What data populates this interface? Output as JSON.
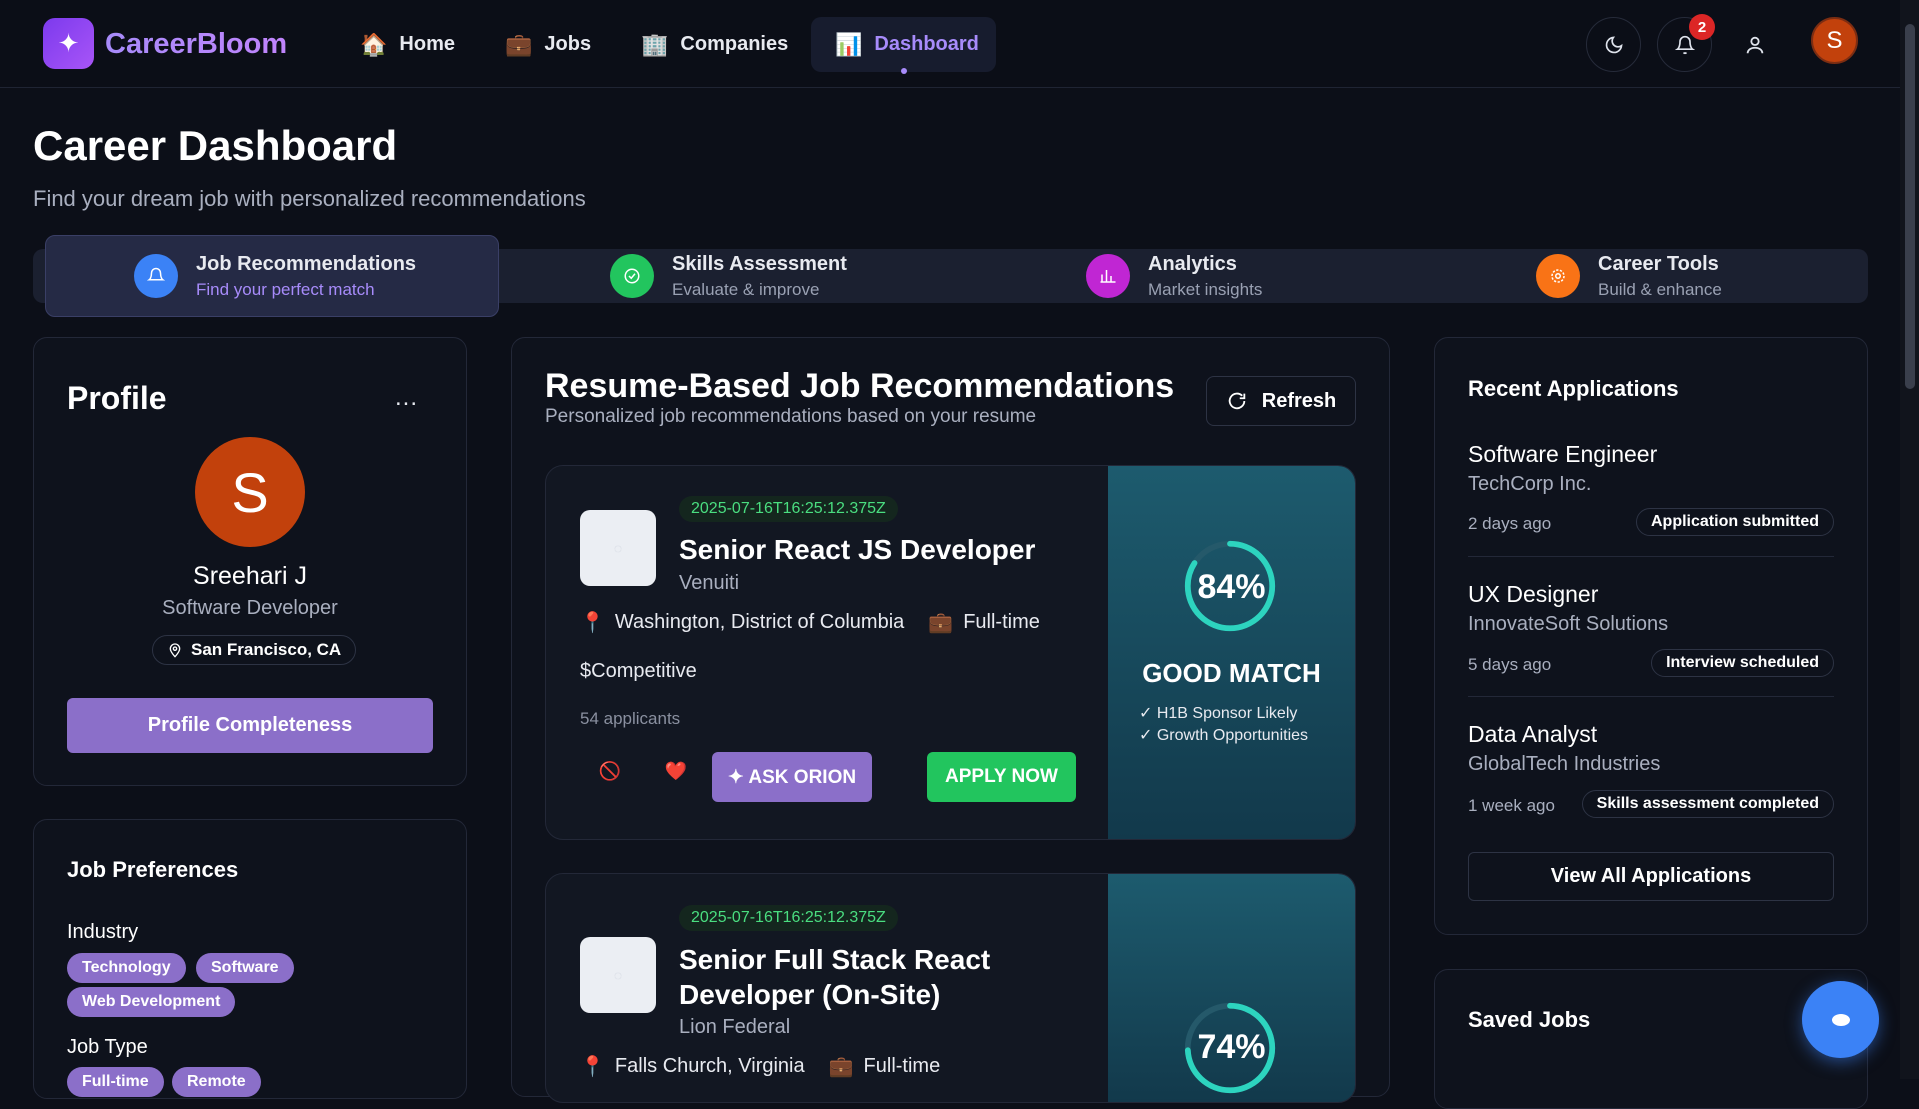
{
  "brand": {
    "name": "CareerBloom"
  },
  "nav": {
    "home": "Home",
    "jobs": "Jobs",
    "companies": "Companies",
    "dashboard": "Dashboard"
  },
  "notifications": {
    "count": "2"
  },
  "user": {
    "initial": "S"
  },
  "page": {
    "title": "Career Dashboard",
    "subtitle": "Find your dream job with personalized recommendations"
  },
  "tabs": [
    {
      "name": "Job Recommendations",
      "sub": "Find your perfect match",
      "color": "#3b82f6"
    },
    {
      "name": "Skills Assessment",
      "sub": "Evaluate & improve",
      "color": "#22c55e"
    },
    {
      "name": "Analytics",
      "sub": "Market insights",
      "color": "#c026d3"
    },
    {
      "name": "Career Tools",
      "sub": "Build & enhance",
      "color": "#f97316"
    }
  ],
  "profile": {
    "title": "Profile",
    "more": "...",
    "initial": "S",
    "name": "Sreehari J",
    "role": "Software Developer",
    "location": "San Francisco, CA",
    "completeness_label": "Profile Completeness"
  },
  "preferences": {
    "title": "Job Preferences",
    "industry_label": "Industry",
    "industries": [
      "Technology",
      "Software",
      "Web Development"
    ],
    "job_type_label": "Job Type",
    "job_types": [
      "Full-time",
      "Remote"
    ]
  },
  "recommendations": {
    "title": "Resume-Based Job Recommendations",
    "subtitle": "Personalized job recommendations based on your resume",
    "refresh_label": "Refresh",
    "jobs": [
      {
        "date": "2025-07-16T16:25:12.375Z",
        "title": "Senior React JS Developer",
        "company": "Venuiti",
        "location": "Washington, District of Columbia",
        "type": "Full-time",
        "salary": "$Competitive",
        "applicants": "54 applicants",
        "ask_label": "✦ ASK ORION",
        "apply_label": "APPLY NOW",
        "match_percent": "84%",
        "match_value": 84,
        "match_label": "GOOD MATCH",
        "points": [
          "✓ H1B Sponsor Likely",
          "✓ Growth Opportunities"
        ]
      },
      {
        "date": "2025-07-16T16:25:12.375Z",
        "title": "Senior Full Stack React Developer (On-Site)",
        "company": "Lion Federal",
        "location": "Falls Church, Virginia",
        "type": "Full-time",
        "match_percent": "74%",
        "match_value": 74
      }
    ]
  },
  "recent_applications": {
    "title": "Recent Applications",
    "items": [
      {
        "job": "Software Engineer",
        "company": "TechCorp Inc.",
        "when": "2 days ago",
        "status": "Application submitted"
      },
      {
        "job": "UX Designer",
        "company": "InnovateSoft Solutions",
        "when": "5 days ago",
        "status": "Interview scheduled"
      },
      {
        "job": "Data Analyst",
        "company": "GlobalTech Industries",
        "when": "1 week ago",
        "status": "Skills assessment completed"
      }
    ],
    "view_all_label": "View All Applications"
  },
  "saved_jobs": {
    "title": "Saved Jobs"
  }
}
